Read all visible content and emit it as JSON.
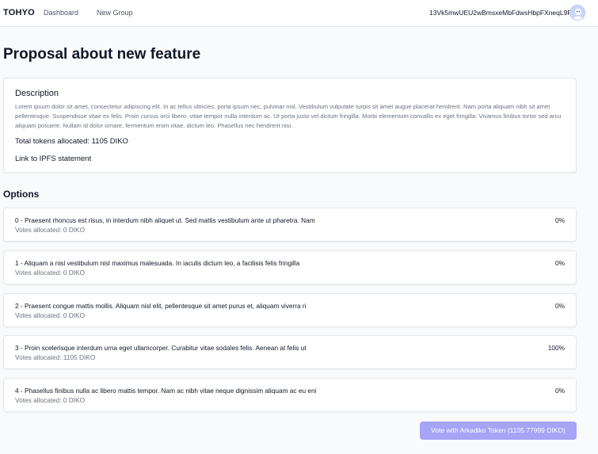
{
  "nav": {
    "brand": "TOHYO",
    "links": [
      "Dashboard",
      "New Group"
    ],
    "address": "13Vk5mwUEU2wBmsxeMbFdwsHbpFXneqL9P",
    "avatar_icon": "user-avatar-icon"
  },
  "proposal": {
    "title": "Proposal about new feature",
    "description_heading": "Description",
    "description": "Lorem ipsum dolor sit amet, consectetur adipiscing elit. In ac tellus ultricies, porta ipsum nec, pulvinar nisl. Vestibulum vulputate turpis sit amet augue placerat hendrerit. Nam porta aliquam nibh sit amet pellentesque. Suspendisse vitae ex felis. Proin cursus orci libero, vitae tempor nulla interdum ac. Ut porta justo vel dictum fringilla. Morbi elementum convallis ex eget fringilla. Vivamus finibus tortor sed arcu aliquam posuere. Nullam id dolor ornare, fermentum enim vitae, dictum leo. Phasellus nec hendrerit nisi.",
    "tokens_allocated": "Total tokens allocated: 1105 DIKO",
    "ipfs_link": "Link to IPFS statement"
  },
  "options_heading": "Options",
  "options": [
    {
      "title": "0 - Praesent rhoncus est risus, in interdum nibh aliquet ut. Sed mattis vestibulum ante ut pharetra. Nam",
      "votes": "Votes allocated: 0 DIKO",
      "percent": "0%"
    },
    {
      "title": "1 - Aliquam a nisl vestibulum nisl maximus malesuada. In iaculis dictum leo, a facilisis felis fringilla",
      "votes": "Votes allocated: 0 DIKO",
      "percent": "0%"
    },
    {
      "title": "2 - Praesent congue mattis mollis. Aliquam nisl elit, pellentesque sit amet purus et, aliquam viverra ri",
      "votes": "Votes allocated: 0 DIKO",
      "percent": "0%"
    },
    {
      "title": "3 - Proin scelerisque interdum urna eget ullamcorper. Curabitur vitae sodales felis. Aenean at felis ut",
      "votes": "Votes allocated: 1105 DIKO",
      "percent": "100%"
    },
    {
      "title": "4 - Phasellus finibus nulla ac libero mattis tempor. Nam ac nibh vitae neque dignissim aliquam ac eu eni",
      "votes": "Votes allocated: 0 DIKO",
      "percent": "0%"
    }
  ],
  "vote_button": "Vote with Arkadiko Token (1105.77999 DIKO)",
  "colors": {
    "accent_button": "#a5a4f5",
    "background": "#f9fafb"
  }
}
